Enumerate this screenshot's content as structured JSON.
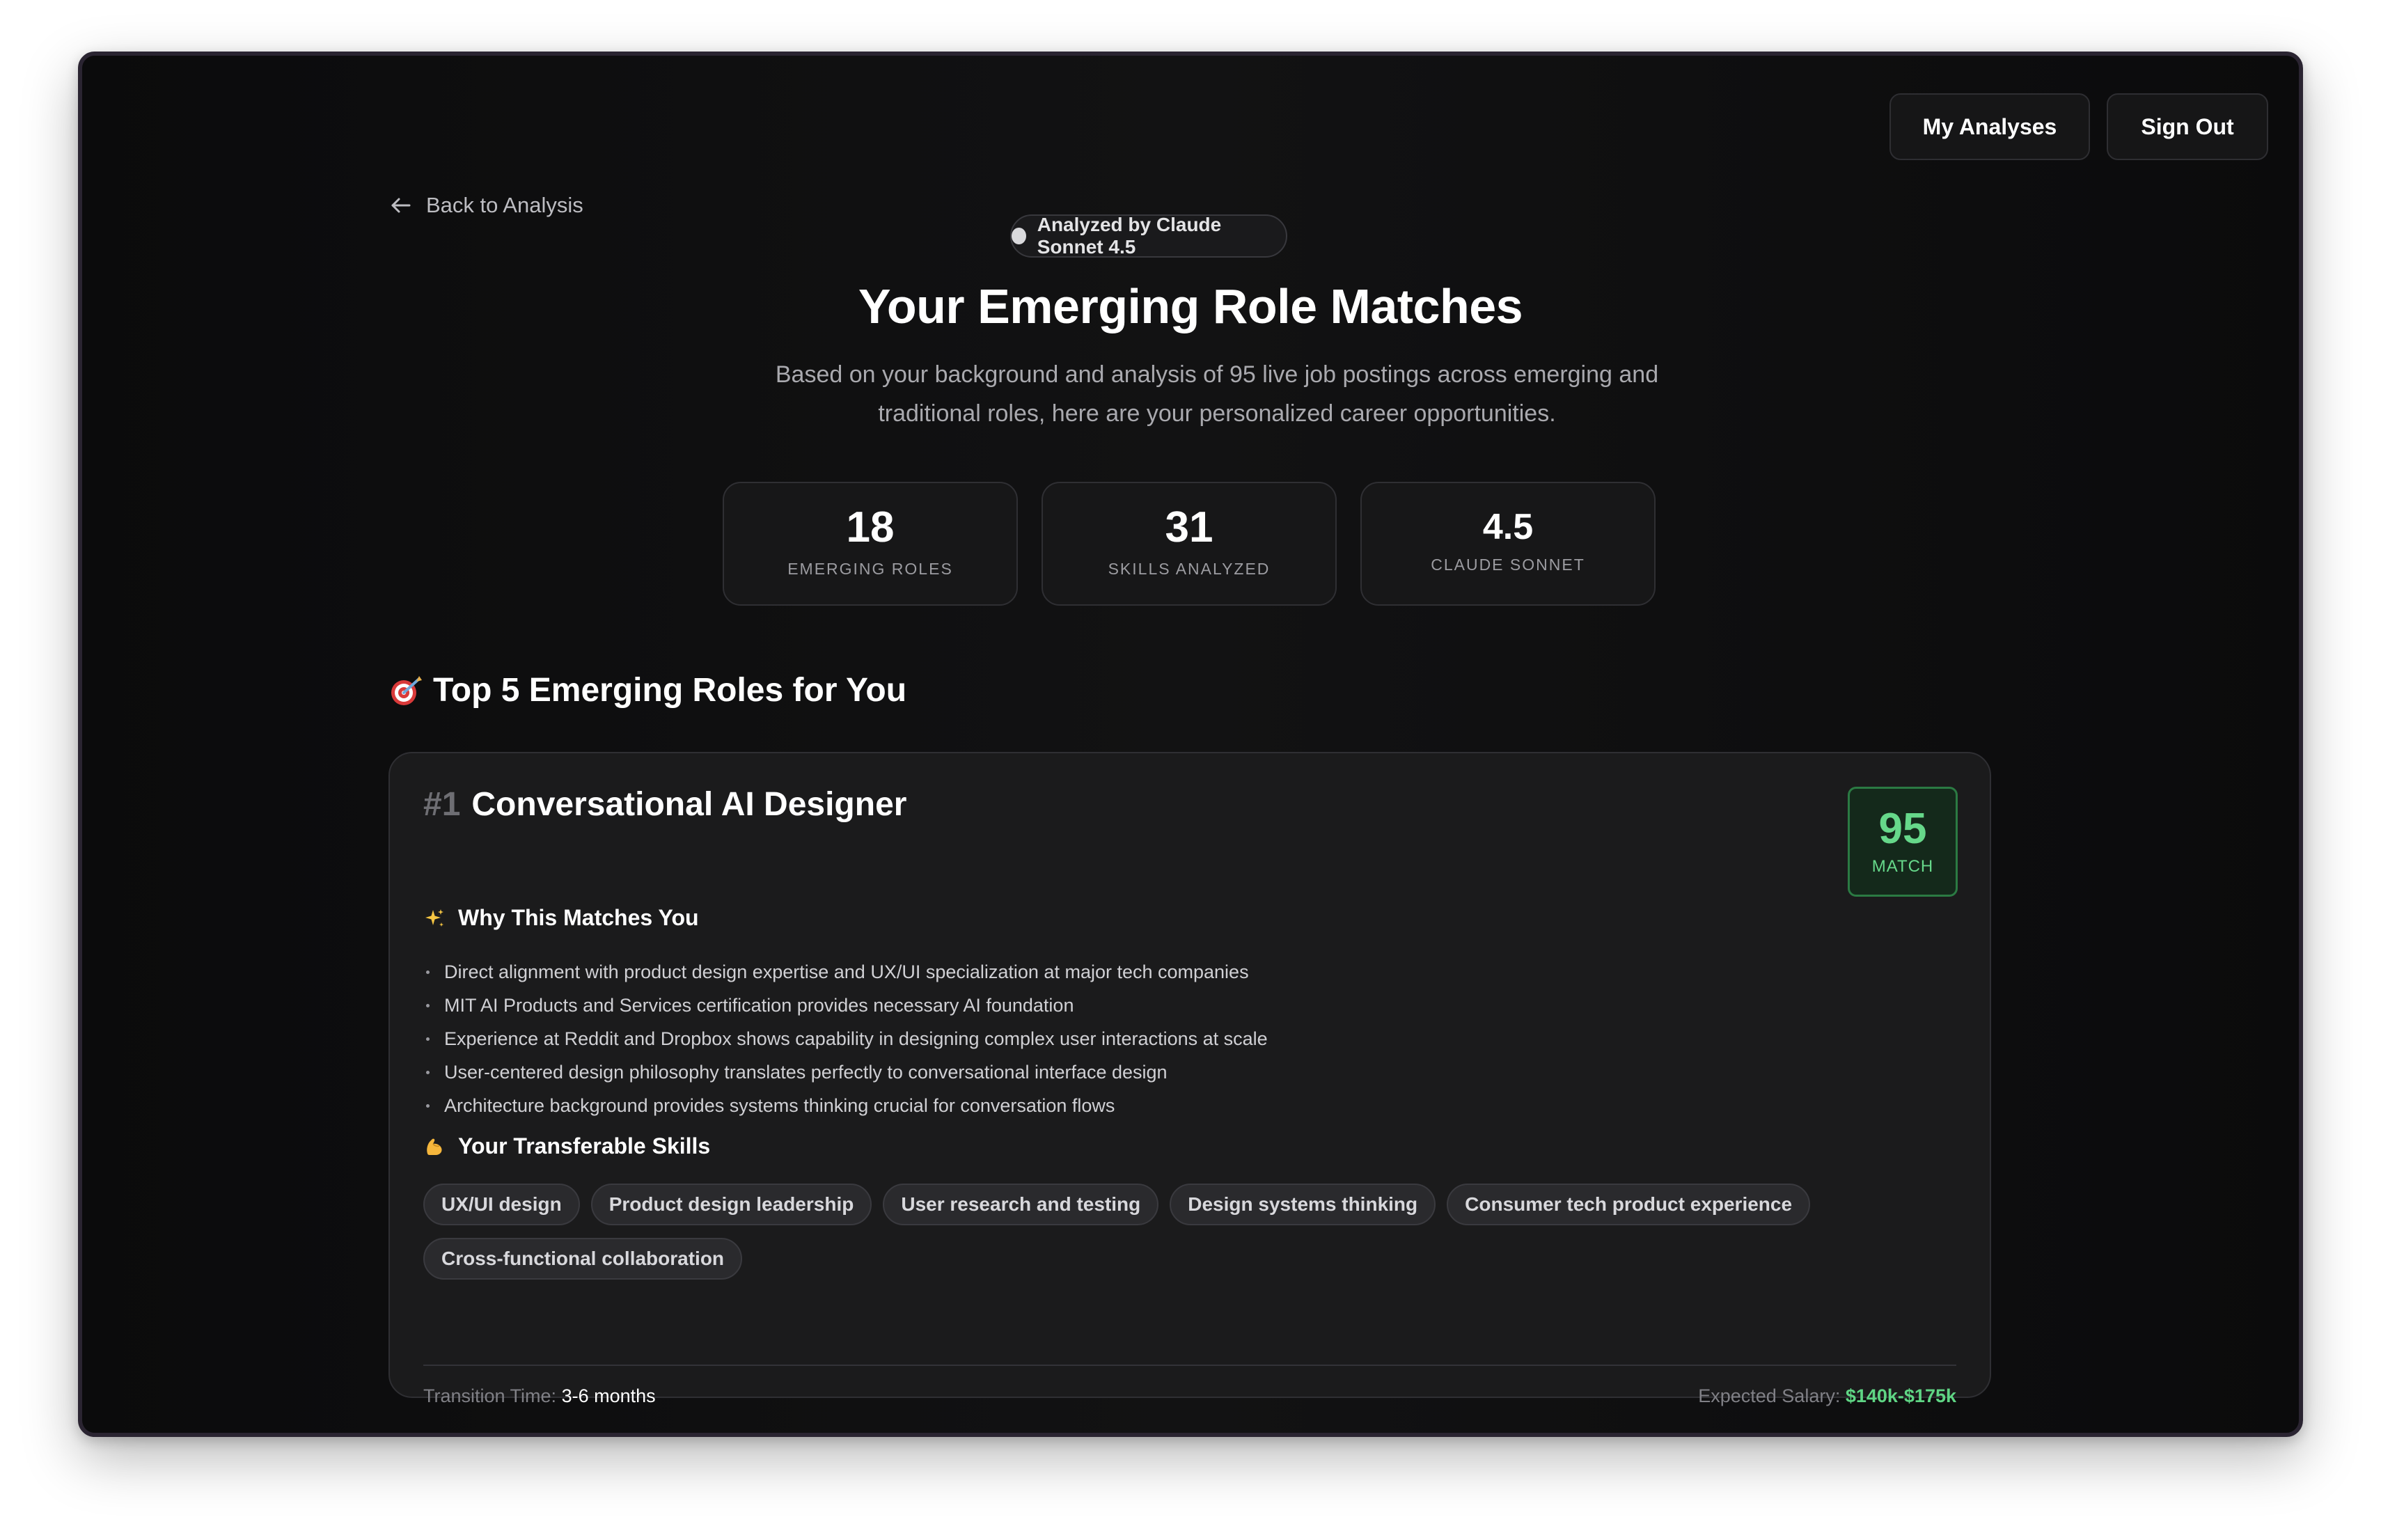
{
  "nav": {
    "back_label": "Back to Analysis",
    "my_analyses_label": "My Analyses",
    "sign_out_label": "Sign Out"
  },
  "header": {
    "badge": "Analyzed by Claude Sonnet 4.5",
    "title": "Your Emerging Role Matches",
    "subtitle": "Based on your background and analysis of 95 live job postings across emerging and traditional roles, here are your personalized career opportunities."
  },
  "stats": [
    {
      "value": "18",
      "label": "EMERGING ROLES"
    },
    {
      "value": "31",
      "label": "SKILLS ANALYZED"
    },
    {
      "value": "4.5",
      "label": "CLAUDE SONNET"
    }
  ],
  "section": {
    "title": "Top 5 Emerging Roles for You",
    "icon": "target-icon"
  },
  "role": {
    "rank": "#1",
    "title": "Conversational AI Designer",
    "match_score": "95",
    "match_label": "MATCH",
    "why_heading": "Why This Matches You",
    "reasons": [
      "Direct alignment with product design expertise and UX/UI specialization at major tech companies",
      "MIT AI Products and Services certification provides necessary AI foundation",
      "Experience at Reddit and Dropbox shows capability in designing complex user interactions at scale",
      "User-centered design philosophy translates perfectly to conversational interface design",
      "Architecture background provides systems thinking crucial for conversation flows"
    ],
    "skills_heading": "Your Transferable Skills",
    "skills": [
      "UX/UI design",
      "Product design leadership",
      "User research and testing",
      "Design systems thinking",
      "Consumer tech product experience",
      "Cross-functional collaboration"
    ],
    "transition_label": "Transition Time:",
    "transition_value": "3-6 months",
    "salary_label": "Expected Salary:",
    "salary_value": "$140k-$175k"
  },
  "colors": {
    "background": "#0e0e0f",
    "card": "#1b1b1c",
    "accent_green": "#66d88a"
  }
}
